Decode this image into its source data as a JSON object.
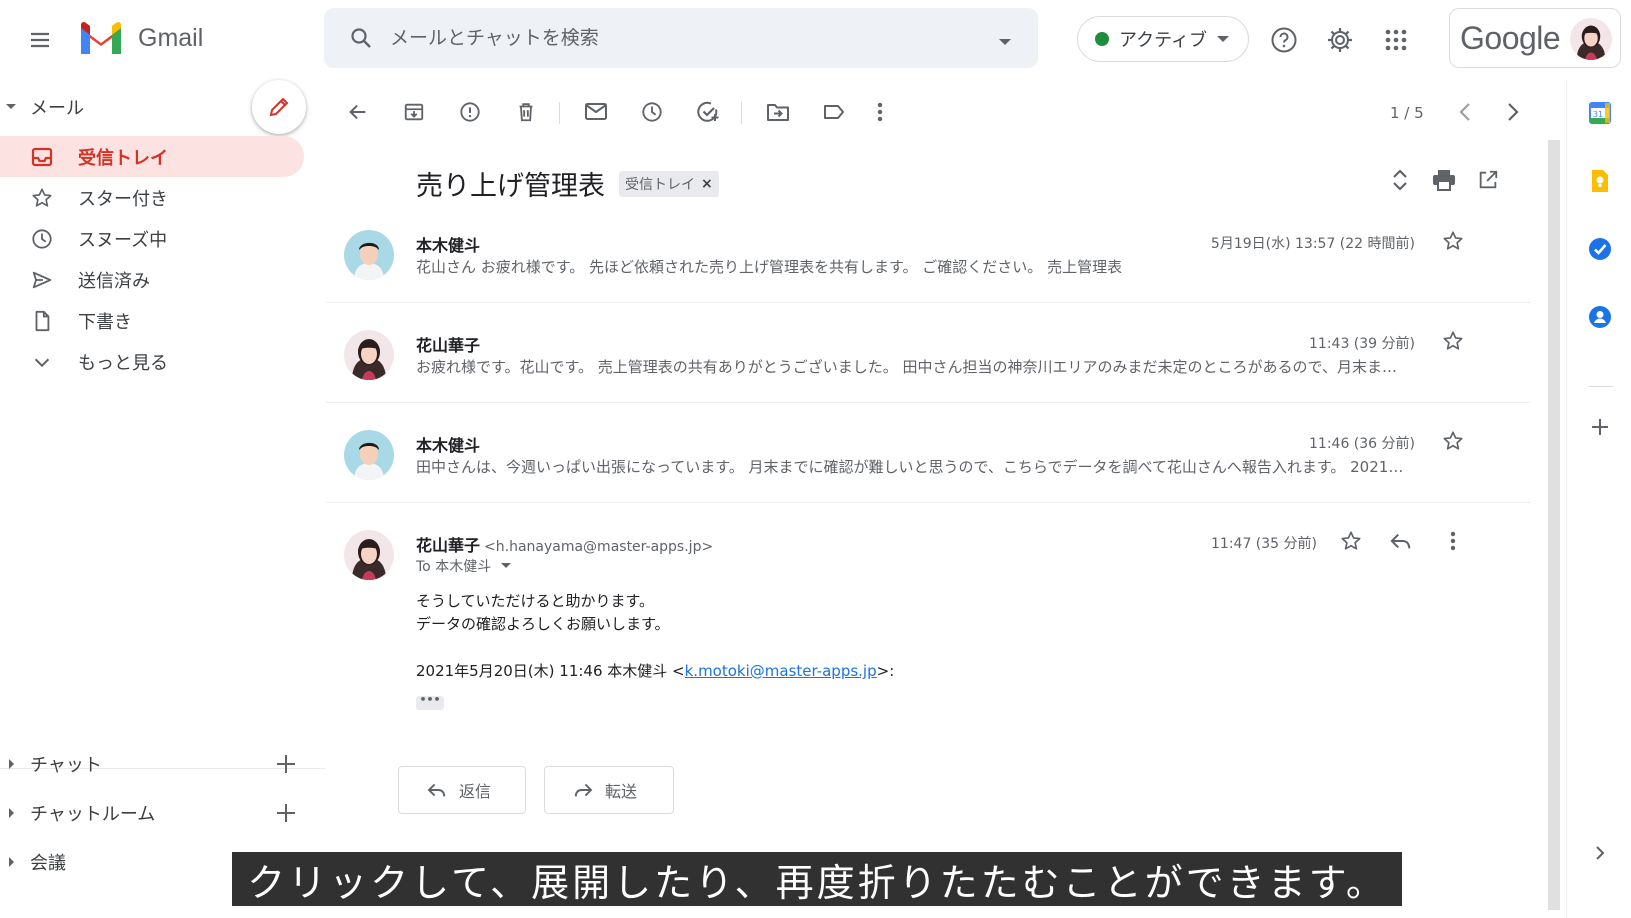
{
  "header": {
    "app_name": "Gmail",
    "search_placeholder": "メールとチャットを検索",
    "status_label": "アクティブ",
    "google_word": "Google"
  },
  "sidebar": {
    "mail_section": "メール",
    "items": [
      {
        "label": "受信トレイ",
        "icon": "inbox-icon",
        "active": true
      },
      {
        "label": "スター付き",
        "icon": "star-icon",
        "active": false
      },
      {
        "label": "スヌーズ中",
        "icon": "clock-icon",
        "active": false
      },
      {
        "label": "送信済み",
        "icon": "send-icon",
        "active": false
      },
      {
        "label": "下書き",
        "icon": "draft-icon",
        "active": false
      },
      {
        "label": "もっと見る",
        "icon": "chevron-down-icon",
        "active": false
      }
    ],
    "chat_section": "チャット",
    "rooms_section": "チャットルーム",
    "meet_section": "会議"
  },
  "toolbar": {
    "pager": "1 / 5"
  },
  "thread": {
    "subject": "売り上げ管理表",
    "label_chip": "受信トレイ",
    "label_chip_close": "×",
    "messages": [
      {
        "sender": "本木健斗",
        "time": "5月19日(水) 13:57 (22 時間前)",
        "snippet": "花山さん お疲れ様です。 先ほど依頼された売り上げ管理表を共有します。 ご確認ください。 売上管理表"
      },
      {
        "sender": "花山華子",
        "time": "11:43 (39 分前)",
        "snippet": "お疲れ様です。花山です。 売上管理表の共有ありがとうございました。 田中さん担当の神奈川エリアのみまだ未定のところがあるので、月末ま…"
      },
      {
        "sender": "本木健斗",
        "time": "11:46 (36 分前)",
        "snippet": "田中さんは、今週いっぱい出張になっています。 月末までに確認が難しいと思うので、こちらでデータを調べて花山さんへ報告入れます。 2021…"
      }
    ],
    "expanded": {
      "sender": "花山華子",
      "sender_email": "<h.hanayama@master-apps.jp>",
      "time": "11:47 (35 分前)",
      "to_line": "To 本木健斗",
      "body_line_1": "そうしていただけると助かります。",
      "body_line_2": "データの確認よろしくお願いします。",
      "quote_prefix": "2021年5月20日(木) 11:46 本木健斗 <",
      "quote_email": "k.motoki@master-apps.jp",
      "quote_suffix": ">:",
      "dots": "•••"
    },
    "reply_label": "返信",
    "forward_label": "転送"
  },
  "caption": "クリックして、展開したり、再度折りたたむことができます。",
  "colors": {
    "active_bg": "#fde2e2",
    "active_text": "#d93025",
    "status_green": "#1e8e3e",
    "link_blue": "#1a73e8"
  }
}
